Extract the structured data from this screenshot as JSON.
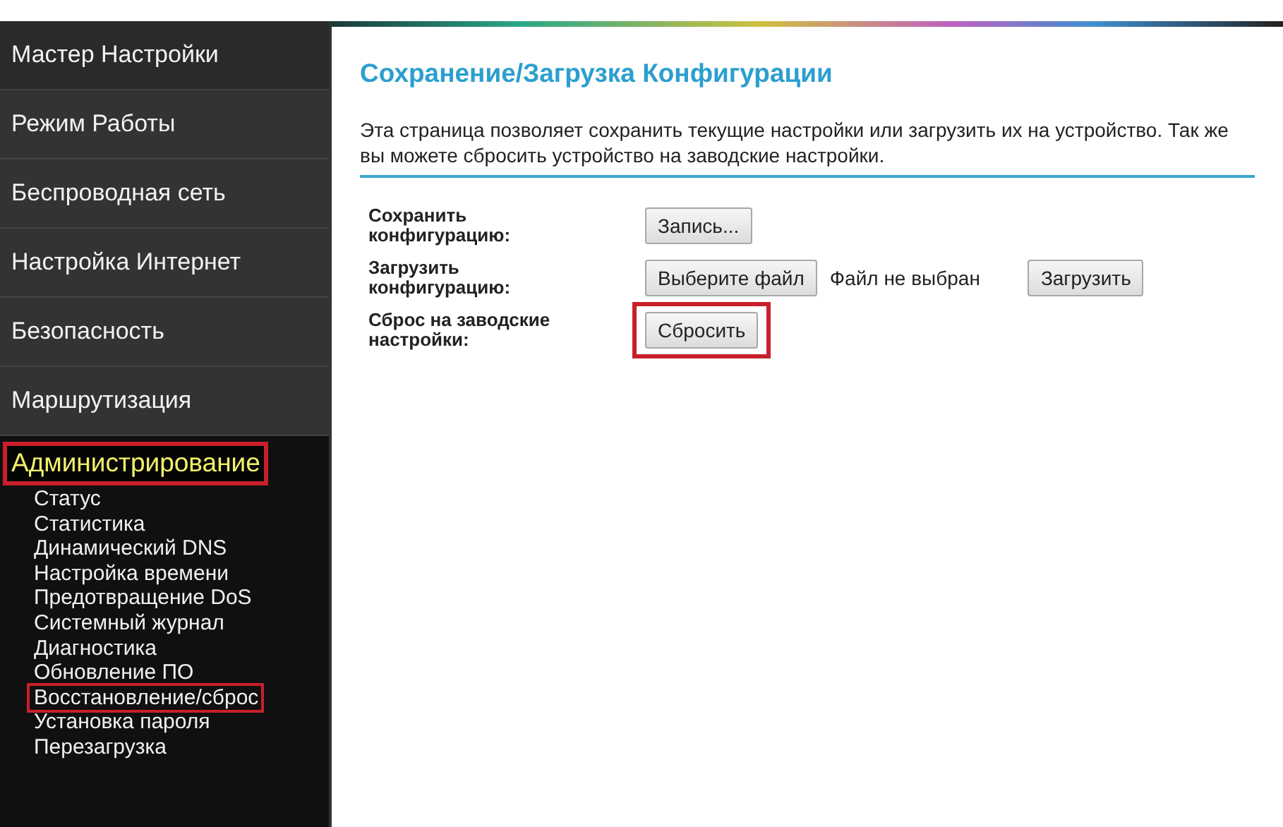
{
  "sidebar": {
    "items": [
      {
        "label": "Мастер Настройки",
        "selected": false,
        "highlighted": false
      },
      {
        "label": "Режим Работы",
        "selected": false,
        "highlighted": false
      },
      {
        "label": "Беспроводная сеть",
        "selected": false,
        "highlighted": false
      },
      {
        "label": "Настройка Интернет",
        "selected": false,
        "highlighted": false
      },
      {
        "label": "Безопасность",
        "selected": false,
        "highlighted": false
      },
      {
        "label": "Маршрутизация",
        "selected": false,
        "highlighted": false
      },
      {
        "label": "Администрирование",
        "selected": true,
        "highlighted": true,
        "children": [
          {
            "label": "Статус",
            "highlighted": false
          },
          {
            "label": "Статистика",
            "highlighted": false
          },
          {
            "label": "Динамический DNS",
            "highlighted": false
          },
          {
            "label": "Настройка времени",
            "highlighted": false
          },
          {
            "label": "Предотвращение DoS",
            "highlighted": false
          },
          {
            "label": "Системный журнал",
            "highlighted": false
          },
          {
            "label": "Диагностика",
            "highlighted": false
          },
          {
            "label": "Обновление ПО",
            "highlighted": false
          },
          {
            "label": "Восстановление/сброс",
            "highlighted": true
          },
          {
            "label": "Установка пароля",
            "highlighted": false
          },
          {
            "label": "Перезагрузка",
            "highlighted": false
          }
        ]
      }
    ]
  },
  "page": {
    "title": "Сохранение/Загрузка Конфигурации",
    "description": "Эта страница позволяет сохранить текущие настройки или загрузить их на устройство. Так же вы можете сбросить устройство на заводские настройки.",
    "rows": [
      {
        "label": "Сохранить конфигурацию:",
        "controls": [
          {
            "kind": "button",
            "text": "Запись...",
            "highlighted": false
          }
        ]
      },
      {
        "label": "Загрузить конфигурацию:",
        "controls": [
          {
            "kind": "button",
            "text": "Выберите файл",
            "highlighted": false
          },
          {
            "kind": "status",
            "text": "Файл не выбран"
          },
          {
            "kind": "button",
            "text": "Загрузить",
            "highlighted": false
          }
        ]
      },
      {
        "label": "Сброс на заводские настройки:",
        "controls": [
          {
            "kind": "button",
            "text": "Сбросить",
            "highlighted": true
          }
        ]
      }
    ]
  }
}
